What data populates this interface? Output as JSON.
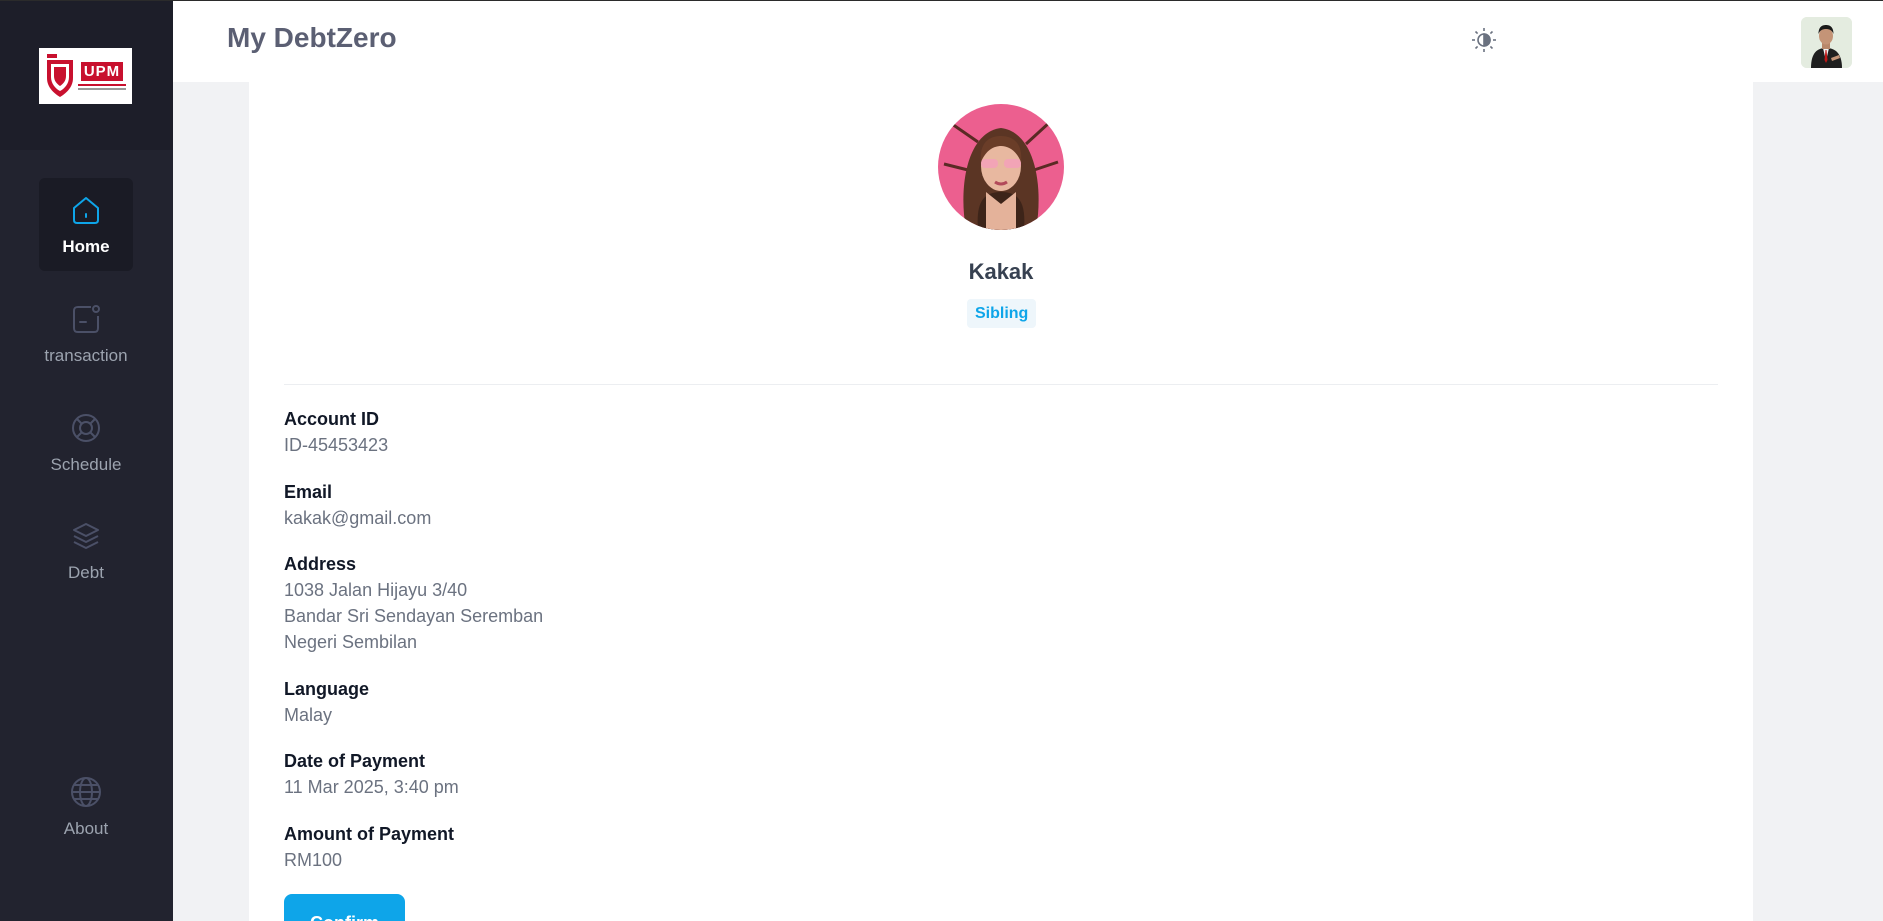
{
  "app": {
    "title": "My DebtZero"
  },
  "sidebar": {
    "items": [
      {
        "label": "Home",
        "icon": "home-icon",
        "active": true
      },
      {
        "label": "transaction",
        "icon": "transaction-icon",
        "active": false
      },
      {
        "label": "Schedule",
        "icon": "lifebuoy-icon",
        "active": false
      },
      {
        "label": "Debt",
        "icon": "layers-icon",
        "active": false
      },
      {
        "label": "About",
        "icon": "globe-icon",
        "active": false
      }
    ]
  },
  "logo": {
    "text": "UPM"
  },
  "profile": {
    "name": "Kakak",
    "relation": "Sibling",
    "fields": [
      {
        "label": "Account ID",
        "value": [
          "ID-45453423"
        ]
      },
      {
        "label": "Email",
        "value": [
          "kakak@gmail.com"
        ]
      },
      {
        "label": "Address",
        "value": [
          "1038 Jalan Hijayu 3/40",
          "Bandar Sri Sendayan Seremban",
          "Negeri Sembilan"
        ]
      },
      {
        "label": "Language",
        "value": [
          "Malay"
        ]
      },
      {
        "label": "Date of Payment",
        "value": [
          "11 Mar 2025, 3:40 pm"
        ]
      },
      {
        "label": "Amount of Payment",
        "value": [
          "RM100"
        ]
      }
    ],
    "confirm_label": "Confirm"
  },
  "colors": {
    "accent": "#0ea5e9",
    "sidebar_bg": "#22232f",
    "badge_bg": "#eef6fb"
  }
}
